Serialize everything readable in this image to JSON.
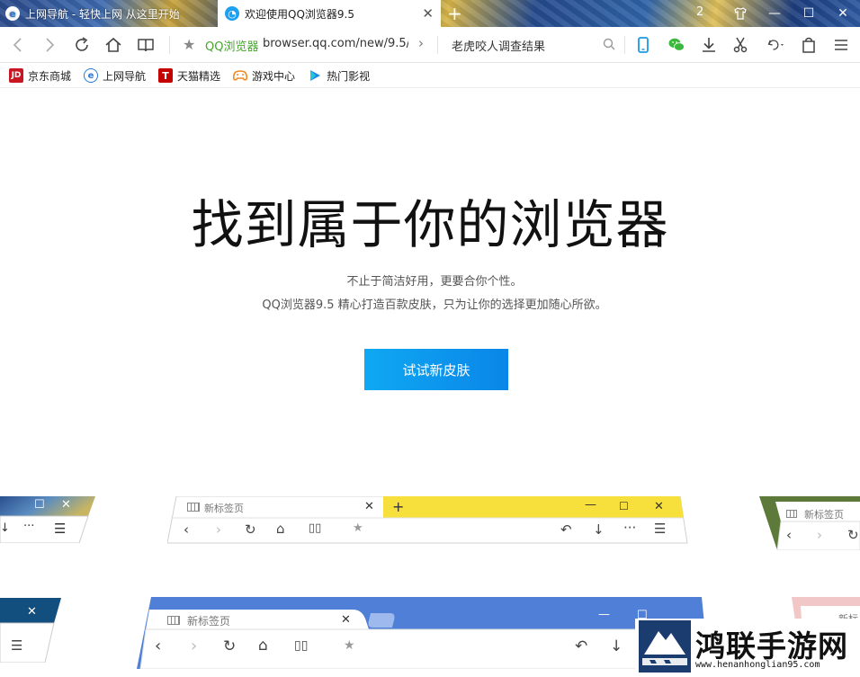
{
  "tabs": [
    {
      "title": "上网导航 - 轻快上网 从这里开始"
    },
    {
      "title": "欢迎使用QQ浏览器9.5"
    }
  ],
  "window": {
    "badge_count": "2"
  },
  "address": {
    "site_label": "QQ浏览器",
    "url": "browser.qq.com/new/9.5/",
    "search_text": "老虎咬人调查结果"
  },
  "bookmarks": [
    {
      "label": "京东商城",
      "icon_text": "JD",
      "color": "#c81623"
    },
    {
      "label": "上网导航",
      "icon_text": "e",
      "color": "#2a78d6"
    },
    {
      "label": "天猫精选",
      "icon_text": "T",
      "color": "#c40000"
    },
    {
      "label": "游戏中心",
      "icon_text": "",
      "color": "#f08a24"
    },
    {
      "label": "热门影视",
      "icon_text": "",
      "color": "#1e88e5"
    }
  ],
  "hero": {
    "title": "找到属于你的浏览器",
    "subtitle_line1": "不止于简洁好用，更要合你个性。",
    "subtitle_line2": "QQ浏览器9.5 精心打造百款皮肤，只为让你的选择更加随心所欲。",
    "cta_label": "试试新皮肤"
  },
  "previews": {
    "center_tab_title": "新标签页",
    "right_tab_title": "新标签页",
    "bottom_tab_title": "新标签页",
    "bottom_right_tab_title": "新标"
  },
  "watermark": {
    "title": "鸿联手游网",
    "url": "www.henanhonglian95.com"
  },
  "colors": {
    "accent": "#0a86e8",
    "yellow_skin": "#f7df3c",
    "blue_skin": "#4f7fd6",
    "site_green": "#46a62d"
  }
}
